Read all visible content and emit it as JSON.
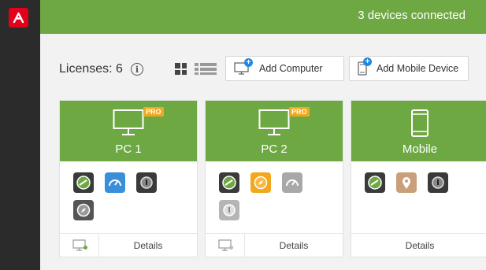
{
  "topbar": {
    "status": "3 devices connected"
  },
  "toolbar": {
    "licenses_label": "Licenses: 6",
    "add_computer_label": "Add Computer",
    "add_mobile_label": "Add Mobile Device"
  },
  "cards": [
    {
      "name": "PC 1",
      "type": "computer",
      "badge": "PRO",
      "details_label": "Details",
      "apps": [
        "speedup-icon",
        "speed-meter-icon",
        "password-manager-icon",
        "safe-browsing-icon"
      ]
    },
    {
      "name": "PC 2",
      "type": "computer",
      "badge": "PRO",
      "details_label": "Details",
      "apps": [
        "speedup-icon",
        "safe-browsing-icon",
        "speed-meter-icon",
        "password-manager-icon"
      ]
    },
    {
      "name": "Mobile",
      "type": "mobile",
      "badge": "",
      "details_label": "Details",
      "apps": [
        "speedup-icon",
        "locator-icon",
        "password-manager-icon"
      ]
    }
  ],
  "colors": {
    "brand_green": "#6ea843",
    "brand_red": "#e3001b",
    "pro_orange": "#f2a81d",
    "rail": "#2b2b2b"
  }
}
